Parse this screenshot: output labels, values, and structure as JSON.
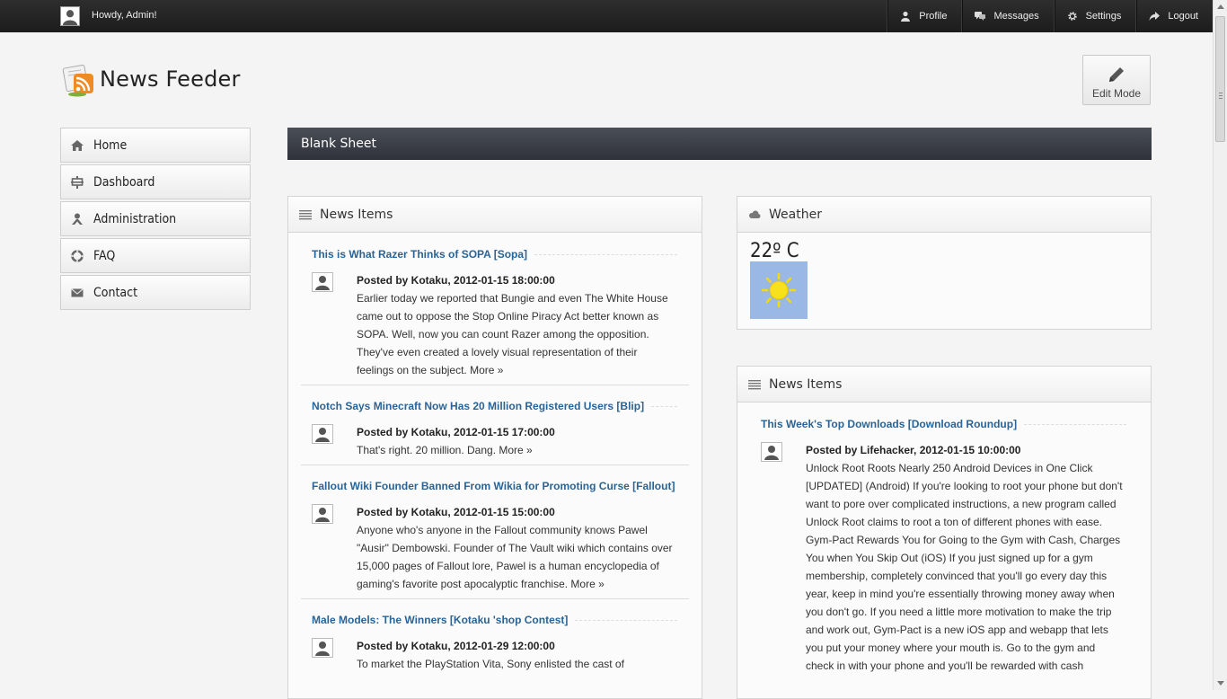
{
  "topbar": {
    "greeting": "Howdy, Admin!",
    "nav": [
      {
        "label": "Profile",
        "icon": "user-icon"
      },
      {
        "label": "Messages",
        "icon": "chat-icon"
      },
      {
        "label": "Settings",
        "icon": "gear-icon"
      },
      {
        "label": "Logout",
        "icon": "share-arrow-icon"
      }
    ]
  },
  "brand": {
    "title": "News Feeder"
  },
  "toolbar": {
    "edit_mode": "Edit Mode"
  },
  "sidebar": {
    "items": [
      {
        "label": "Home",
        "icon": "home-icon"
      },
      {
        "label": "Dashboard",
        "icon": "dashboard-icon"
      },
      {
        "label": "Administration",
        "icon": "admin-icon"
      },
      {
        "label": "FAQ",
        "icon": "lifebuoy-icon"
      },
      {
        "label": "Contact",
        "icon": "envelope-icon"
      }
    ]
  },
  "page": {
    "title": "Blank Sheet"
  },
  "news_left": {
    "title": "News Items",
    "items": [
      {
        "title": "This is What Razer Thinks of SOPA [Sopa]",
        "meta": "Posted by Kotaku, 2012-01-15 18:00:00",
        "body": "Earlier today we reported that Bungie and even The White House came out to oppose the Stop Online Piracy Act better known as SOPA. Well, now you can count Razer among the opposition. They've even created a lovely visual representation of their feelings on the subject.",
        "more": "More »"
      },
      {
        "title": "Notch Says Minecraft Now Has 20 Million Registered Users [Blip]",
        "meta": "Posted by Kotaku, 2012-01-15 17:00:00",
        "body": "That's right. 20 million. Dang.",
        "more": "More »"
      },
      {
        "title": "Fallout Wiki Founder Banned From Wikia for Promoting Curse [Fallout]",
        "meta": "Posted by Kotaku, 2012-01-15 15:00:00",
        "body": "Anyone who's anyone in the Fallout community knows Pawel \"Ausir\" Dembowski. Founder of The Vault wiki which contains over 15,000 pages of Fallout lore, Pawel is a human encyclopedia of gaming's favorite post apocalyptic franchise.",
        "more": "More »"
      },
      {
        "title": "Male Models: The Winners [Kotaku 'shop Contest]",
        "meta": "Posted by Kotaku, 2012-01-29 12:00:00",
        "body": "To market the PlayStation Vita, Sony enlisted the cast of",
        "more": ""
      }
    ]
  },
  "weather": {
    "title": "Weather",
    "temperature": "22º C",
    "condition_icon": "sun-icon"
  },
  "news_right": {
    "title": "News Items",
    "items": [
      {
        "title": "This Week's Top Downloads [Download Roundup]",
        "meta": "Posted by Lifehacker, 2012-01-15 10:00:00",
        "body": "Unlock Root Roots Nearly 250 Android Devices in One Click [UPDATED] (Android) If you're looking to root your phone but don't want to pore over complicated instructions, a new program called Unlock Root claims to root a ton of different phones with ease. Gym-Pact Rewards You for Going to the Gym with Cash, Charges You when You Skip Out (iOS) If you just signed up for a gym membership, completely convinced that you'll go every day this year, keep in mind you're essentially throwing money away when you don't go. If you need a little more motivation to make the trip and work out, Gym-Pact is a new iOS app and webapp that lets you put your money where your mouth is. Go to the gym and check in with your phone and you'll be rewarded with cash"
      }
    ]
  }
}
